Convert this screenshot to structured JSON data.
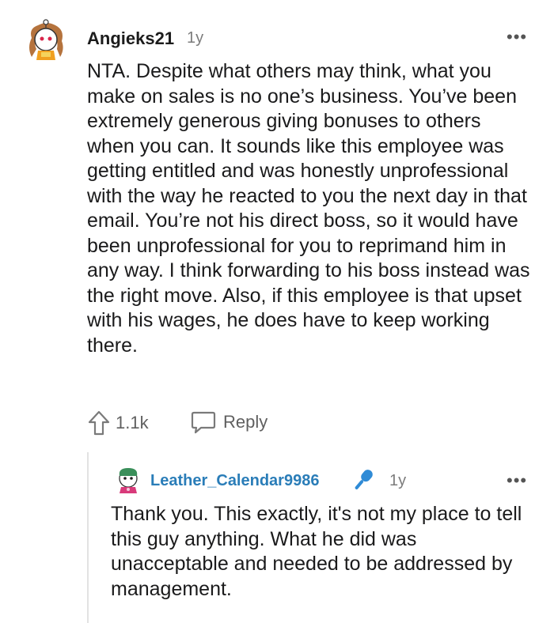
{
  "comment": {
    "username": "Angieks21",
    "age": "1y",
    "more_label": "•••",
    "body": "NTA. Despite what others may think, what you make on sales is no one’s business. You’ve been extremely generous giving bonuses to others when you can. It sounds like this employee was getting entitled and was honestly unprofessional with the way he reacted to you the next day in that email. You’re not his direct boss, so it would have been unprofessional for you to reprimand him in any way. I think forwarding to his boss instead was the right move. Also, if this employee is that upset with his wages, he does have to keep working there.",
    "upvotes": "1.1k",
    "reply_label": "Reply",
    "icons": {
      "upvote": "upvote-arrow-icon",
      "reply": "speech-bubble-icon",
      "more": "more-options-icon"
    }
  },
  "reply": {
    "username": "Leather_Calendar9986",
    "age": "1y",
    "more_label": "•••",
    "body": "Thank you. This exactly, it's not my place to tell this guy anything. What he did was unacceptable and needed to be addressed by management.",
    "icons": {
      "op_badge": "microphone-icon"
    }
  },
  "colors": {
    "username_link": "#2a7db8",
    "mic_badge": "#2f8bd6",
    "muted": "#7c7c7c"
  }
}
